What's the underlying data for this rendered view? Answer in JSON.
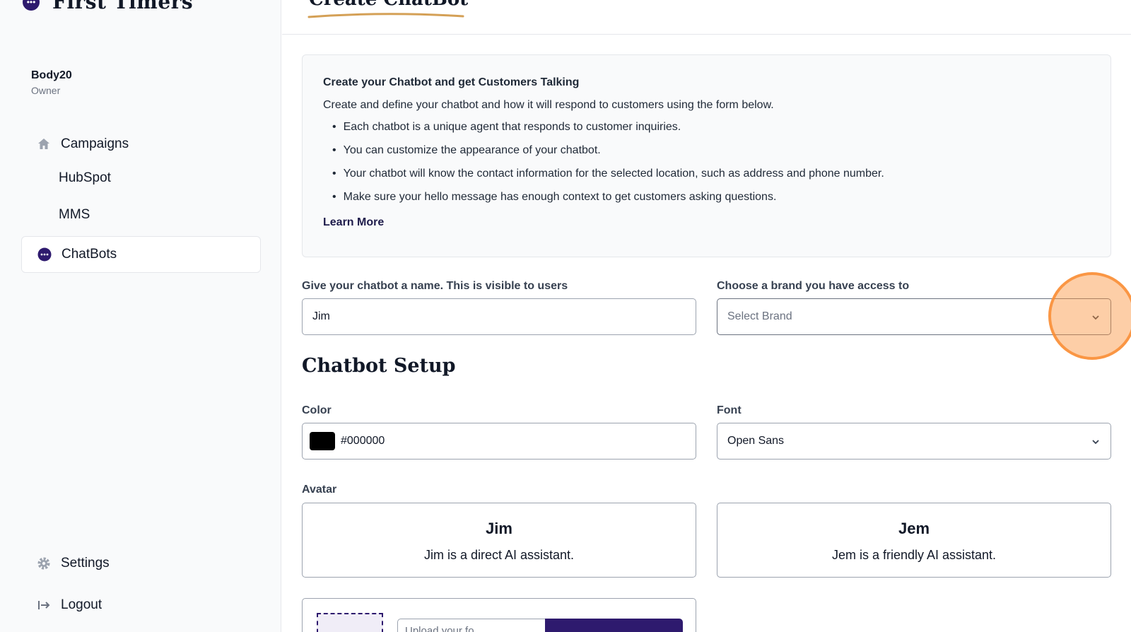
{
  "app": {
    "brand_name": "First Timers"
  },
  "user": {
    "name": "Body20",
    "role": "Owner"
  },
  "sidebar": {
    "items": [
      {
        "label": "Campaigns",
        "icon": "home-icon"
      },
      {
        "label": "HubSpot"
      },
      {
        "label": "MMS"
      },
      {
        "label": "ChatBots",
        "icon": "chat-bubble-icon",
        "active": true
      }
    ],
    "bottom": [
      {
        "label": "Settings",
        "icon": "gear-icon"
      },
      {
        "label": "Logout",
        "icon": "logout-icon"
      }
    ]
  },
  "header": {
    "title": "Create ChatBot"
  },
  "info": {
    "heading": "Create your Chatbot and get Customers Talking",
    "intro": "Create and define your chatbot and how it will respond to customers using the form below.",
    "bullets": [
      "Each chatbot is a unique agent that responds to customer inquiries.",
      "You can customize the appearance of your chatbot.",
      "Your chatbot will know the contact information for the selected location, such as address and phone number.",
      "Make sure your hello message has enough context to get customers asking questions."
    ],
    "learn_more": "Learn More"
  },
  "form": {
    "name_label": "Give your chatbot a name. This is visible to users",
    "name_value": "Jim",
    "brand_label": "Choose a brand you have access to",
    "brand_placeholder": "Select Brand",
    "setup_title": "Chatbot Setup",
    "color_label": "Color",
    "color_value": "#000000",
    "font_label": "Font",
    "font_value": "Open Sans",
    "avatar_label": "Avatar",
    "avatars": [
      {
        "name": "Jim",
        "description": "Jim is a direct AI assistant."
      },
      {
        "name": "Jem",
        "description": "Jem is a friendly AI assistant."
      }
    ],
    "upload_placeholder": "Upload your fo..."
  },
  "colors": {
    "primary": "#2e1a6e",
    "highlight": "#f98c32",
    "sidebar_bg": "#f9fafb",
    "underline": "#d4a056"
  }
}
